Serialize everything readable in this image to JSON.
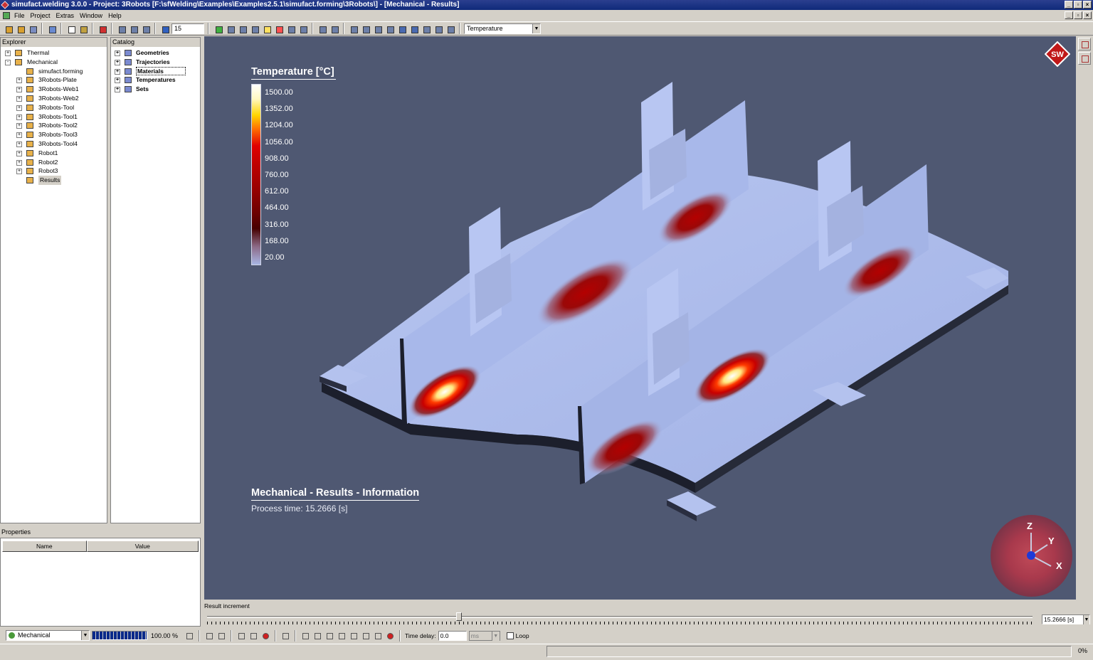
{
  "window": {
    "title": "simufact.welding 3.0.0 - Project: 3Robots [F:\\sfWelding\\Examples\\Examples2.5.1\\simufact.forming\\3Robots\\] - [Mechanical - Results]"
  },
  "menu": [
    "File",
    "Project",
    "Extras",
    "Window",
    "Help"
  ],
  "toolbar": {
    "step_value": "15",
    "result_combo": "Temperature"
  },
  "explorer": {
    "title": "Explorer",
    "items": [
      {
        "label": "Thermal",
        "depth": 0,
        "expander": "+",
        "icon": "robot-group-icon"
      },
      {
        "label": "Mechanical",
        "depth": 0,
        "expander": "-",
        "icon": "robot-group-icon"
      },
      {
        "label": "simufact.forming",
        "depth": 1,
        "expander": "",
        "icon": "forming-icon"
      },
      {
        "label": "3Robots-Plate",
        "depth": 1,
        "expander": "+",
        "icon": "part-icon"
      },
      {
        "label": "3Robots-Web1",
        "depth": 1,
        "expander": "+",
        "icon": "part-icon"
      },
      {
        "label": "3Robots-Web2",
        "depth": 1,
        "expander": "+",
        "icon": "part-icon"
      },
      {
        "label": "3Robots-Tool",
        "depth": 1,
        "expander": "+",
        "icon": "tool-icon"
      },
      {
        "label": "3Robots-Tool1",
        "depth": 1,
        "expander": "+",
        "icon": "tool-icon"
      },
      {
        "label": "3Robots-Tool2",
        "depth": 1,
        "expander": "+",
        "icon": "tool-icon"
      },
      {
        "label": "3Robots-Tool3",
        "depth": 1,
        "expander": "+",
        "icon": "tool-icon"
      },
      {
        "label": "3Robots-Tool4",
        "depth": 1,
        "expander": "+",
        "icon": "tool-icon"
      },
      {
        "label": "Robot1",
        "depth": 1,
        "expander": "+",
        "icon": "robot-icon"
      },
      {
        "label": "Robot2",
        "depth": 1,
        "expander": "+",
        "icon": "robot-icon"
      },
      {
        "label": "Robot3",
        "depth": 1,
        "expander": "+",
        "icon": "robot-icon"
      },
      {
        "label": "Results",
        "depth": 1,
        "expander": "",
        "icon": "results-icon",
        "selected": true
      }
    ]
  },
  "catalog": {
    "title": "Catalog",
    "items": [
      {
        "label": "Geometries",
        "icon": "geometries-icon"
      },
      {
        "label": "Trajectories",
        "icon": "trajectories-icon"
      },
      {
        "label": "Materials",
        "icon": "materials-icon",
        "focused": true
      },
      {
        "label": "Temperatures",
        "icon": "temperatures-icon"
      },
      {
        "label": "Sets",
        "icon": "sets-icon"
      }
    ]
  },
  "properties": {
    "title": "Properties",
    "columns": [
      "Name",
      "Value"
    ]
  },
  "viewport": {
    "legend_title": "Temperature [°C]",
    "legend_values": [
      "1500.00",
      "1352.00",
      "1204.00",
      "1056.00",
      "908.00",
      "760.00",
      "612.00",
      "464.00",
      "316.00",
      "168.00",
      "20.00"
    ],
    "info_title": "Mechanical - Results - Information",
    "info_line": "Process time:  15.2666 [s]",
    "logo_text": "SW",
    "axes": {
      "z": "Z",
      "y": "Y",
      "x": "X"
    },
    "background_color": "#4f5872"
  },
  "increment": {
    "label": "Result increment",
    "value": "15.2666 [s]",
    "position_fraction": 0.306
  },
  "bottombar": {
    "process_combo": "Mechanical",
    "progress_pct": "100.00 %",
    "time_delay_label": "Time delay:",
    "time_delay_value": "0.0",
    "time_unit": "ms",
    "loop_label": "Loop"
  },
  "status": {
    "pct": "0%"
  }
}
